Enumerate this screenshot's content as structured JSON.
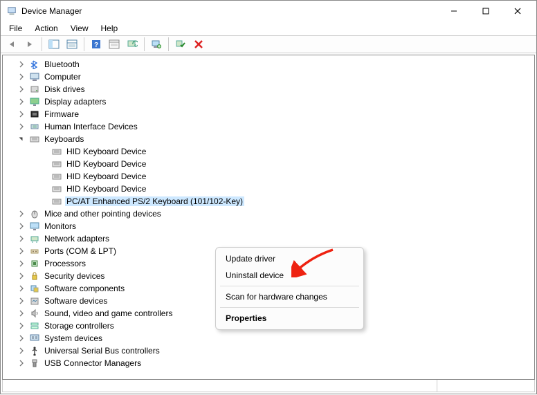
{
  "window": {
    "title": "Device Manager"
  },
  "menubar": [
    "File",
    "Action",
    "View",
    "Help"
  ],
  "toolbar_icons": [
    "back",
    "forward",
    "sep",
    "up-level",
    "show-hide",
    "sep",
    "help",
    "properties",
    "refresh",
    "sep",
    "display",
    "sep",
    "update",
    "uninstall"
  ],
  "tree": {
    "items": [
      {
        "label": "Bluetooth",
        "icon": "bluetooth",
        "expand": "closed"
      },
      {
        "label": "Computer",
        "icon": "computer",
        "expand": "closed"
      },
      {
        "label": "Disk drives",
        "icon": "disk",
        "expand": "closed"
      },
      {
        "label": "Display adapters",
        "icon": "display",
        "expand": "closed"
      },
      {
        "label": "Firmware",
        "icon": "firmware",
        "expand": "closed"
      },
      {
        "label": "Human Interface Devices",
        "icon": "hid",
        "expand": "closed"
      },
      {
        "label": "Keyboards",
        "icon": "keyboard",
        "expand": "open",
        "children": [
          {
            "label": "HID Keyboard Device"
          },
          {
            "label": "HID Keyboard Device"
          },
          {
            "label": "HID Keyboard Device"
          },
          {
            "label": "HID Keyboard Device"
          },
          {
            "label": "PC/AT Enhanced PS/2 Keyboard (101/102-Key)",
            "selected": true
          }
        ]
      },
      {
        "label": "Mice and other pointing devices",
        "icon": "mouse",
        "expand": "closed"
      },
      {
        "label": "Monitors",
        "icon": "monitor",
        "expand": "closed"
      },
      {
        "label": "Network adapters",
        "icon": "network",
        "expand": "closed"
      },
      {
        "label": "Ports (COM & LPT)",
        "icon": "ports",
        "expand": "closed"
      },
      {
        "label": "Processors",
        "icon": "cpu",
        "expand": "closed"
      },
      {
        "label": "Security devices",
        "icon": "security",
        "expand": "closed"
      },
      {
        "label": "Software components",
        "icon": "swcomp",
        "expand": "closed"
      },
      {
        "label": "Software devices",
        "icon": "swdev",
        "expand": "closed"
      },
      {
        "label": "Sound, video and game controllers",
        "icon": "sound",
        "expand": "closed"
      },
      {
        "label": "Storage controllers",
        "icon": "storage",
        "expand": "closed"
      },
      {
        "label": "System devices",
        "icon": "system",
        "expand": "closed"
      },
      {
        "label": "Universal Serial Bus controllers",
        "icon": "usb",
        "expand": "closed"
      },
      {
        "label": "USB Connector Managers",
        "icon": "usbconn",
        "expand": "closed"
      }
    ]
  },
  "context_menu": {
    "items": [
      {
        "label": "Update driver",
        "type": "item"
      },
      {
        "label": "Uninstall device",
        "type": "item"
      },
      {
        "type": "sep"
      },
      {
        "label": "Scan for hardware changes",
        "type": "item"
      },
      {
        "type": "sep"
      },
      {
        "label": "Properties",
        "type": "item",
        "bold": true
      }
    ]
  }
}
